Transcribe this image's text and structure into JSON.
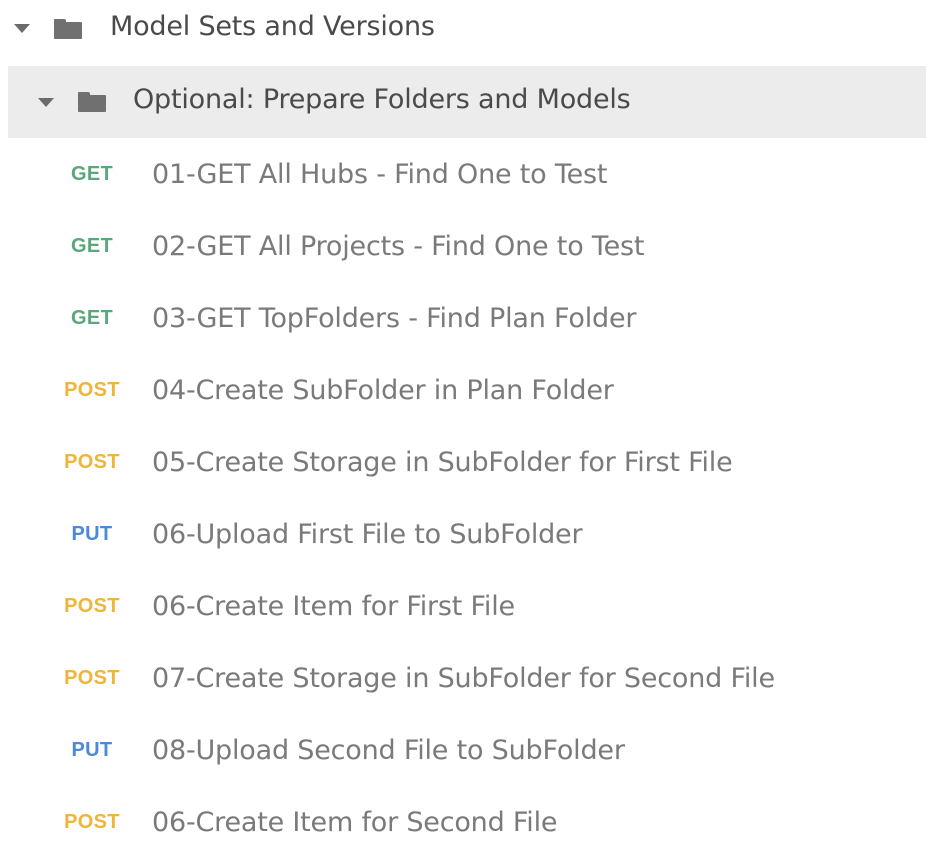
{
  "collection": {
    "label": "Model Sets and Versions",
    "icon": "folder-icon",
    "expanded": true
  },
  "folder": {
    "label": "Optional: Prepare Folders and Models",
    "icon": "folder-icon",
    "expanded": true
  },
  "requests": [
    {
      "method": "GET",
      "label": "01-GET All Hubs - Find One to Test"
    },
    {
      "method": "GET",
      "label": "02-GET All Projects - Find One to Test"
    },
    {
      "method": "GET",
      "label": "03-GET TopFolders - Find Plan Folder"
    },
    {
      "method": "POST",
      "label": "04-Create SubFolder in Plan Folder"
    },
    {
      "method": "POST",
      "label": "05-Create Storage in SubFolder for First File"
    },
    {
      "method": "PUT",
      "label": "06-Upload First File to SubFolder"
    },
    {
      "method": "POST",
      "label": "06-Create Item for First File"
    },
    {
      "method": "POST",
      "label": "07-Create Storage in SubFolder for Second File"
    },
    {
      "method": "PUT",
      "label": "08-Upload Second File to SubFolder"
    },
    {
      "method": "POST",
      "label": "06-Create Item for Second File"
    }
  ],
  "colors": {
    "GET": "#5ba77d",
    "POST": "#f0b43a",
    "PUT": "#4a8ad8",
    "folder_highlight": "#ececec"
  }
}
